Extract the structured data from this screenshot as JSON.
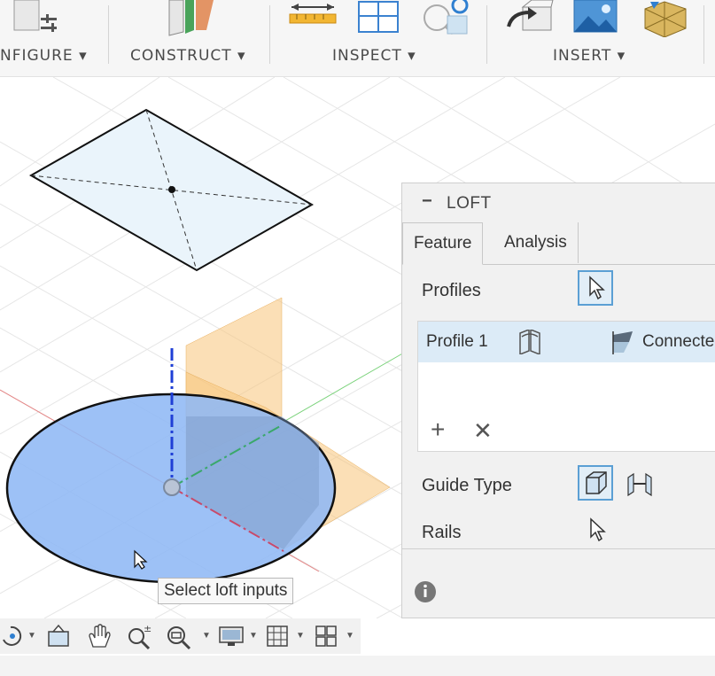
{
  "toolbar": {
    "groups": [
      {
        "label": "NFIGURE ▾"
      },
      {
        "label": "CONSTRUCT ▾"
      },
      {
        "label": "INSPECT ▾"
      },
      {
        "label": "INSERT ▾"
      }
    ]
  },
  "loft": {
    "title": "LOFT",
    "tabs": [
      {
        "label": "Feature"
      },
      {
        "label": "Analysis"
      }
    ],
    "profiles_label": "Profiles",
    "profile_rows": [
      {
        "name": "Profile 1",
        "continuity": "Connecte"
      }
    ],
    "guide_type_label": "Guide Type",
    "rails_label": "Rails"
  },
  "tooltip": "Select loft inputs",
  "colors": {
    "accent": "#5b9fd4",
    "selection_fill": "#8fb8f5",
    "plane_orange": "#f7c57a",
    "axis_blue": "#1f3fd6",
    "axis_red": "#e06a6a",
    "axis_green": "#59c259"
  }
}
